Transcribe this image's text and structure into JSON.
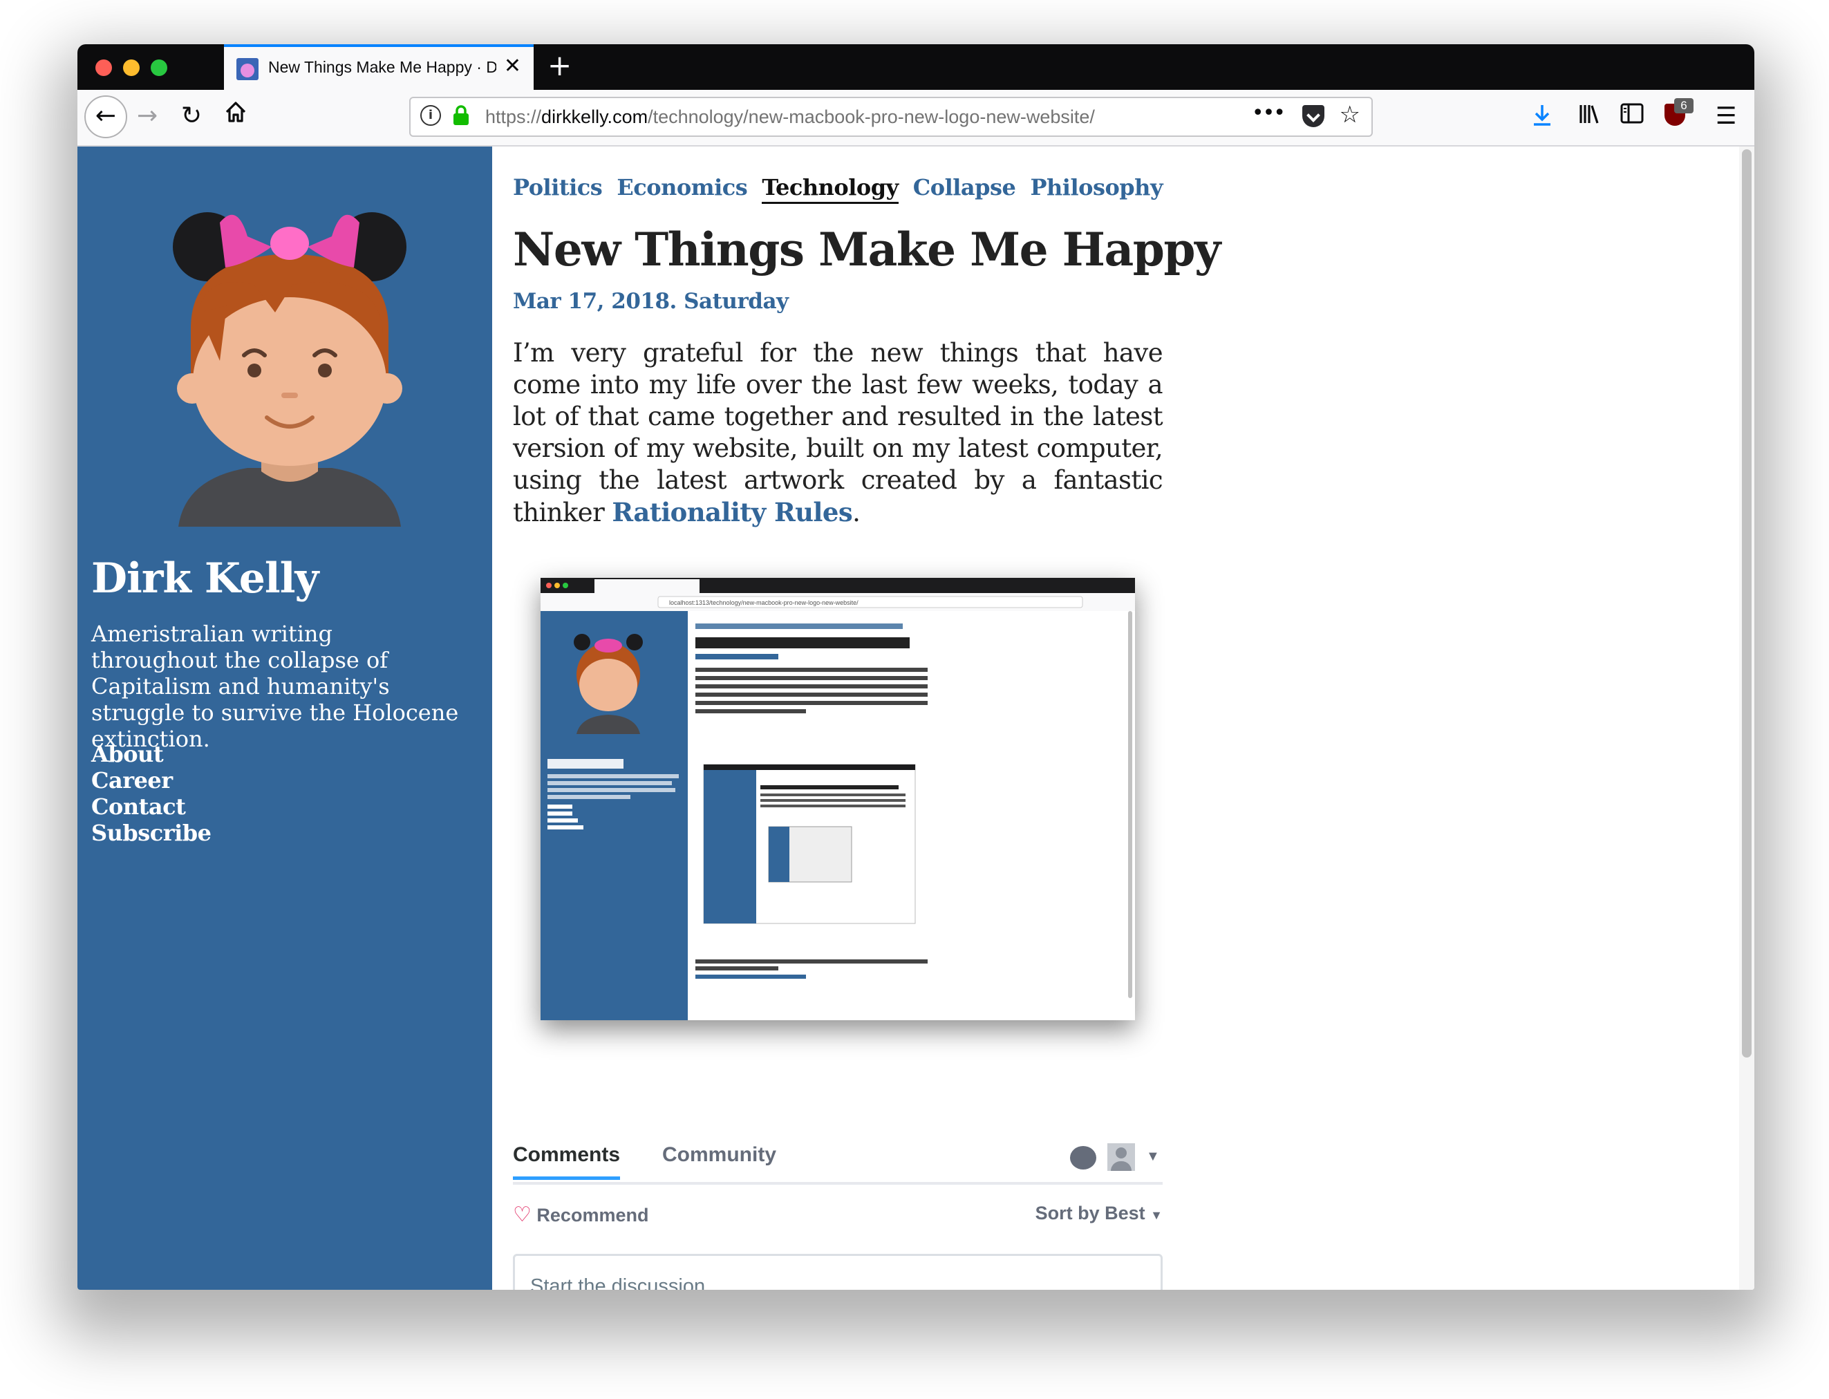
{
  "browser": {
    "tab_title": "New Things Make Me Happy · D",
    "url_prefix": "https://",
    "url_domain": "dirkkelly.com",
    "url_path": "/technology/new-macbook-pro-new-logo-new-website/",
    "ublock_count": "6",
    "accent_color": "#0a84ff"
  },
  "sidebar": {
    "name": "Dirk Kelly",
    "bio": "Ameristralian writing throughout the collapse of Capitalism and humanity's struggle to survive the Holocene extinction.",
    "links": [
      "About",
      "Career",
      "Contact",
      "Subscribe"
    ],
    "background_color": "#336699"
  },
  "categories": [
    "Politics",
    "Economics",
    "Technology",
    "Collapse",
    "Philosophy"
  ],
  "active_category": "Technology",
  "post": {
    "title": "New Things Make Me Happy",
    "date": "Mar 17, 2018. Saturday",
    "body": "I’m very grateful for the new things that have come into my life over the last few weeks, today a lot of that came together and resulted in the latest version of my website, built on my latest computer, using the latest artwork created by a fantastic thinker ",
    "link_text": "Rationality Rules",
    "body_end": "."
  },
  "screenshot": {
    "url": "localhost:1313/technology/new-macbook-pro-new-logo-new-website/",
    "disqus_note": "Disqus comments not available by default when the website is previewed locally.",
    "disqus_link": "comments powered by Disqus"
  },
  "comments": {
    "tab_comments": "Comments",
    "tab_community": "Community",
    "recommend": "Recommend",
    "sort": "Sort by Best",
    "placeholder": "Start the discussion..."
  },
  "icons": [
    "back-icon",
    "forward-icon",
    "reload-icon",
    "home-icon",
    "info-icon",
    "lock-icon",
    "page-actions-icon",
    "pocket-icon",
    "bookmark-star-icon",
    "downloads-icon",
    "library-icon",
    "sidebar-icon",
    "ublock-icon",
    "menu-icon"
  ]
}
